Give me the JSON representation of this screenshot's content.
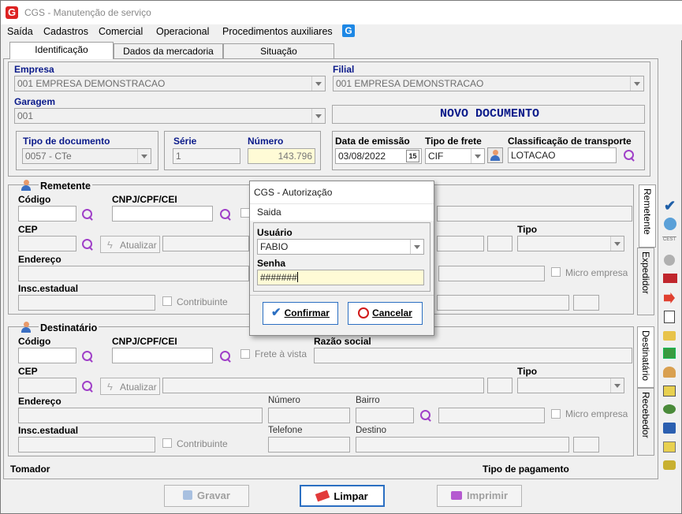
{
  "window": {
    "title": "CGS - Manutenção de serviço"
  },
  "menu": [
    "Saída",
    "Cadastros",
    "Comercial",
    "Operacional",
    "Procedimentos auxiliares"
  ],
  "tabs": [
    "Identificação",
    "Dados da mercadoria",
    "Situação"
  ],
  "header": {
    "empresa_label": "Empresa",
    "empresa_value": "001 EMPRESA DEMONSTRACAO",
    "filial_label": "Filial",
    "filial_value": "001 EMPRESA DEMONSTRACAO",
    "garagem_label": "Garagem",
    "garagem_value": "001",
    "status": "NOVO DOCUMENTO",
    "tipo_doc_label": "Tipo de documento",
    "tipo_doc_value": "0057 - CTe",
    "serie_label": "Série",
    "serie_value": "1",
    "numero_label": "Número",
    "numero_value": "143.796",
    "data_label": "Data de emissão",
    "data_value": "03/08/2022",
    "calendar_day": "15",
    "frete_label": "Tipo de frete",
    "frete_value": "CIF",
    "class_label": "Classificação de transporte",
    "class_value": "LOTACAO"
  },
  "remetente": {
    "title": "Remetente",
    "codigo": "Código",
    "cnpj": "CNPJ/CPF/CEI",
    "cep": "CEP",
    "atualizar": "Atualizar",
    "tipo": "Tipo",
    "endereco": "Endereço",
    "micro": "Micro empresa",
    "insc": "Insc.estadual",
    "contribuinte": "Contribuinte"
  },
  "destinatario": {
    "title": "Destinatário",
    "codigo": "Código",
    "cnpj": "CNPJ/CPF/CEI",
    "frete_vista": "Frete à vista",
    "razao": "Razão social",
    "cep": "CEP",
    "atualizar": "Atualizar",
    "tipo": "Tipo",
    "endereco": "Endereço",
    "numero": "Número",
    "bairro": "Bairro",
    "micro": "Micro empresa",
    "insc": "Insc.estadual",
    "contribuinte": "Contribuinte",
    "telefone": "Telefone",
    "destino": "Destino"
  },
  "side_tabs": [
    "Remetente",
    "Expedidor",
    "Destinatário",
    "Recebedor"
  ],
  "footer": {
    "tomador": "Tomador",
    "tipo_pagamento": "Tipo de pagamento",
    "gravar": "Gravar",
    "limpar": "Limpar",
    "imprimir": "Imprimir"
  },
  "dialog": {
    "title": "CGS - Autorização",
    "subtitle": "Saida",
    "usuario_label": "Usuário",
    "usuario_value": "FABIO",
    "senha_label": "Senha",
    "senha_value": "#######",
    "confirmar": "Confirmar",
    "cancelar": "Cancelar"
  },
  "colors": {
    "label_blue": "#0a1a8a",
    "status_blue": "#0a1a8a",
    "yellow_field": "#fffbd6",
    "lens_purple": "#a040c8"
  },
  "side_icons": [
    "check-icon",
    "network-icon",
    "cest-icon",
    "circle-icon",
    "truck-icon",
    "exit-icon",
    "documents-icon",
    "hand-point-icon",
    "chart-icon",
    "person-icon",
    "calculator-icon",
    "route-icon",
    "book-icon",
    "bill-icon",
    "money-icon"
  ]
}
